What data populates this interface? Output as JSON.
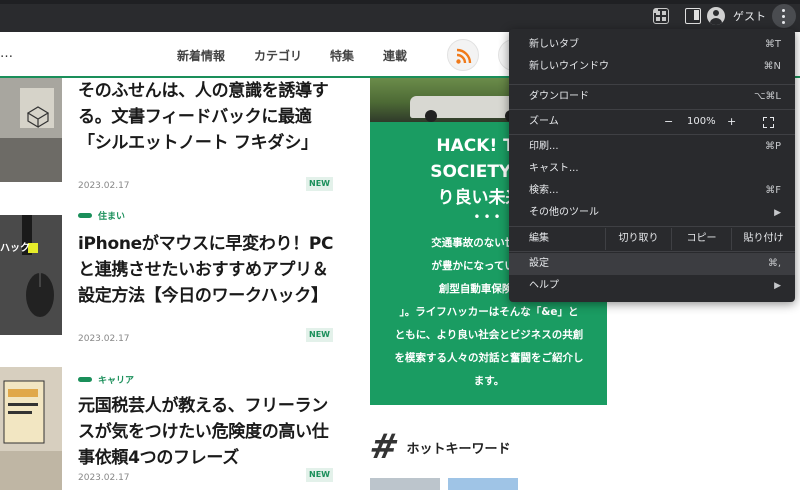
{
  "browser": {
    "profile_label": "ゲスト"
  },
  "header": {
    "logo_fragment": "…",
    "nav": [
      "新着情報",
      "カテゴリ",
      "特集",
      "連載"
    ]
  },
  "articles": [
    {
      "category": "",
      "title": "そのふせんは、人の意識を誘導する。文書フィードバックに最適「シルエットノート フキダシ」",
      "date": "2023.02.17",
      "badge": "NEW"
    },
    {
      "category": "住まい",
      "title": "iPhoneがマウスに早変わり！PCと連携させたいおすすめアプリ＆設定方法【今日のワークハック】",
      "date": "2023.02.17",
      "badge": "NEW",
      "thumb_text": "ハック"
    },
    {
      "category": "キャリア",
      "title": "元国税芸人が教える、フリーランスが気をつけたい危険度の高い仕事依頼4つのフレーズ",
      "date": "2023.02.17",
      "badge": "NEW"
    }
  ],
  "promo": {
    "heading_lines": [
      "HACK! THE",
      "SOCIETY wit",
      "り良い未来の"
    ],
    "dots": "•••",
    "body_lines": [
      "交通事故のない世界を目",
      "が豊かになっていくこと",
      "創型自動車保険「&e",
      "」。ライフハッカーはそんな「&e」と",
      "ともに、より良い社会とビジネスの共創",
      "を模索する人々の対話と奮闘をご紹介し",
      "ます。"
    ]
  },
  "hot_keywords": {
    "icon": "#",
    "label": "ホットキーワード"
  },
  "menu": {
    "items": [
      {
        "label": "新しいタブ",
        "shortcut": "⌘T"
      },
      {
        "label": "新しいウインドウ",
        "shortcut": "⌘N"
      },
      {
        "label": "ダウンロード",
        "shortcut": "⌥⌘L"
      },
      {
        "label": "ズーム"
      },
      {
        "label": "印刷...",
        "shortcut": "⌘P"
      },
      {
        "label": "キャスト..."
      },
      {
        "label": "検索...",
        "shortcut": "⌘F"
      },
      {
        "label": "その他のツール",
        "arrow": "▶"
      },
      {
        "label": "編集"
      },
      {
        "label": "設定",
        "shortcut": "⌘,"
      },
      {
        "label": "ヘルプ",
        "arrow": "▶"
      }
    ],
    "zoom": {
      "minus": "−",
      "value": "100%",
      "plus": "+"
    },
    "edit": {
      "cut": "切り取り",
      "copy": "コピー",
      "paste": "貼り付け"
    }
  }
}
